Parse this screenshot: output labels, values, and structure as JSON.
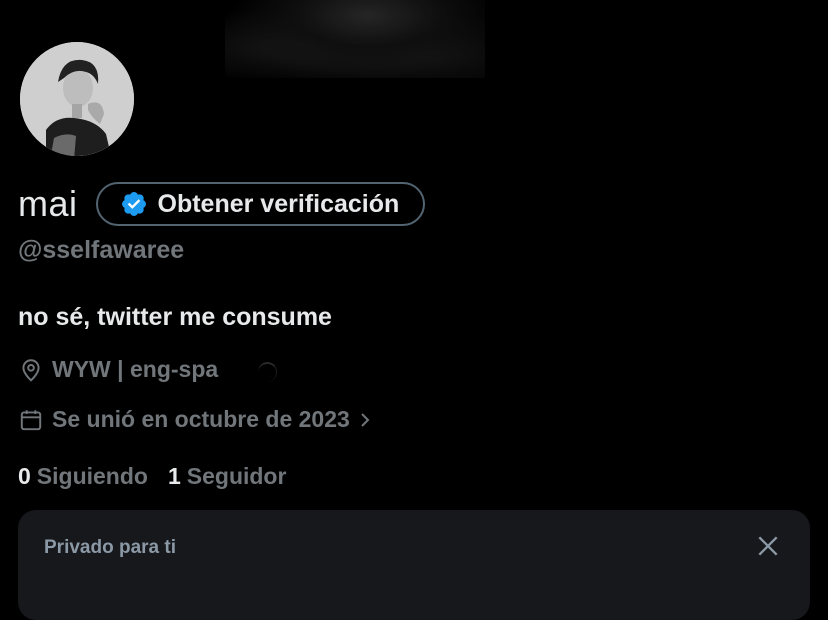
{
  "profile": {
    "display_name": "mai",
    "handle": "@sselfawaree",
    "bio": "no sé, twitter me consume",
    "location": "WYW | eng-spa",
    "joined": "Se unió en octubre de 2023",
    "verify_button_label": "Obtener verificación"
  },
  "stats": {
    "following_count": "0",
    "following_label": "Siguiendo",
    "followers_count": "1",
    "followers_label": "Seguidor"
  },
  "private_card": {
    "label": "Privado para ti"
  },
  "icons": {
    "verified": "verified-badge-icon",
    "location": "location-pin-icon",
    "calendar": "calendar-icon",
    "chevron": "chevron-right-icon",
    "close": "close-icon"
  },
  "colors": {
    "background": "#000000",
    "text_primary": "#e7e9ea",
    "text_secondary": "#71767b",
    "verified_blue": "#1d9bf0",
    "card_background": "#16181c"
  }
}
